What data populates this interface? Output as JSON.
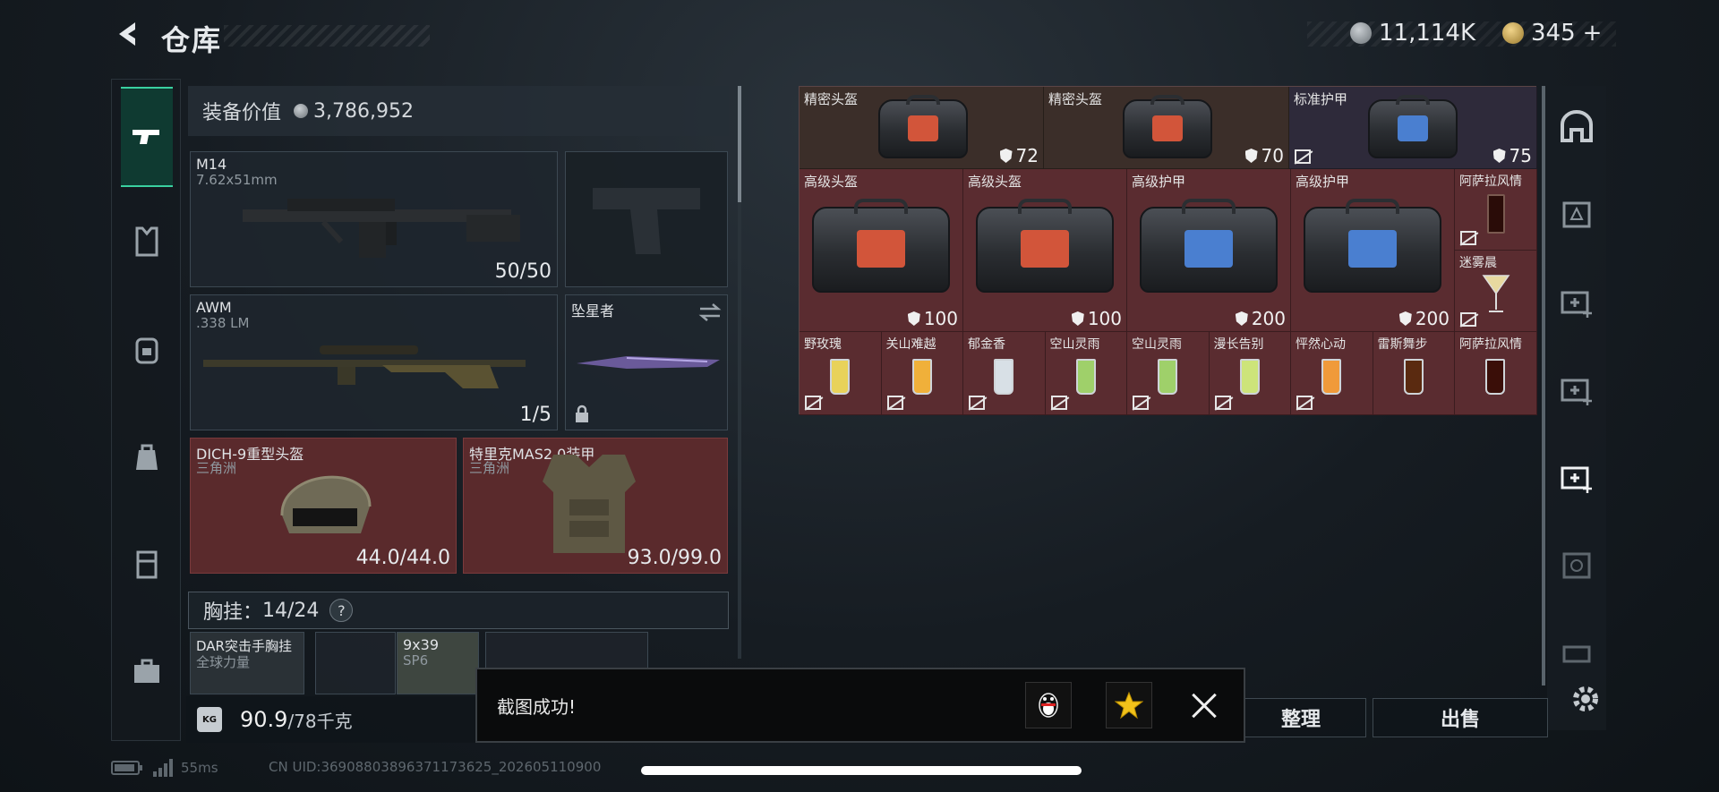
{
  "header": {
    "title": "仓库",
    "currency_silver": "11,114K",
    "currency_gold": "345",
    "currency_gold_add": "+"
  },
  "sidebar": {
    "items": [
      "gun-icon",
      "vest-icon",
      "backpack-icon",
      "bag-icon",
      "rig-icon",
      "case-icon"
    ]
  },
  "equipment": {
    "value_label": "装备价值",
    "value": "3,786,952",
    "primary": {
      "name": "M14",
      "ammo": "7.62x51mm",
      "count": "50/50"
    },
    "secondary": {
      "name": "AWM",
      "ammo": ".338 LM",
      "count": "1/5"
    },
    "melee": {
      "name": "坠星者"
    },
    "helmet": {
      "name": "DICH-9重型头盔",
      "sub": "三角洲",
      "durability": "44.0/44.0"
    },
    "armor": {
      "name": "特里克MAS2.0装甲",
      "sub": "三角洲",
      "durability": "93.0/99.0"
    },
    "chest_label": "胸挂：",
    "chest_value": "14/24",
    "chest_help": "?",
    "rig": {
      "name": "DAR突击手胸挂",
      "sub": "全球力量"
    },
    "ammo_item": {
      "name": "9x39",
      "sub": "SP6"
    },
    "weight": "90.9",
    "weight_cap": "/78千克",
    "weight_icon_text": "KG"
  },
  "grid": {
    "row1": [
      {
        "label": "精密头盔",
        "value": "72",
        "color": "#d2553a"
      },
      {
        "label": "精密头盔",
        "value": "70",
        "color": "#d2553a"
      },
      {
        "label": "标准护甲",
        "value": "75",
        "color": "#4a7fd0"
      }
    ],
    "row2": [
      {
        "label": "高级头盔",
        "value": "100",
        "color": "#d2553a"
      },
      {
        "label": "高级头盔",
        "value": "100",
        "color": "#d2553a"
      },
      {
        "label": "高级护甲",
        "value": "200",
        "color": "#4a7fd0"
      },
      {
        "label": "高级护甲",
        "value": "200",
        "color": "#4a7fd0"
      }
    ],
    "side_drinks": [
      "阿萨拉风情",
      "迷雾晨"
    ],
    "drinks": [
      "野玫瑰",
      "关山难越",
      "郁金香",
      "空山灵雨",
      "空山灵雨",
      "漫长告别",
      "怦然心动",
      "雷斯舞步",
      "阿萨拉风情"
    ]
  },
  "actions": {
    "sort": "整理",
    "sell": "出售"
  },
  "toast": {
    "text": "截图成功!"
  },
  "status": {
    "ping": "55ms",
    "uid": "CN UID:36908803896371173625_202605110900"
  }
}
